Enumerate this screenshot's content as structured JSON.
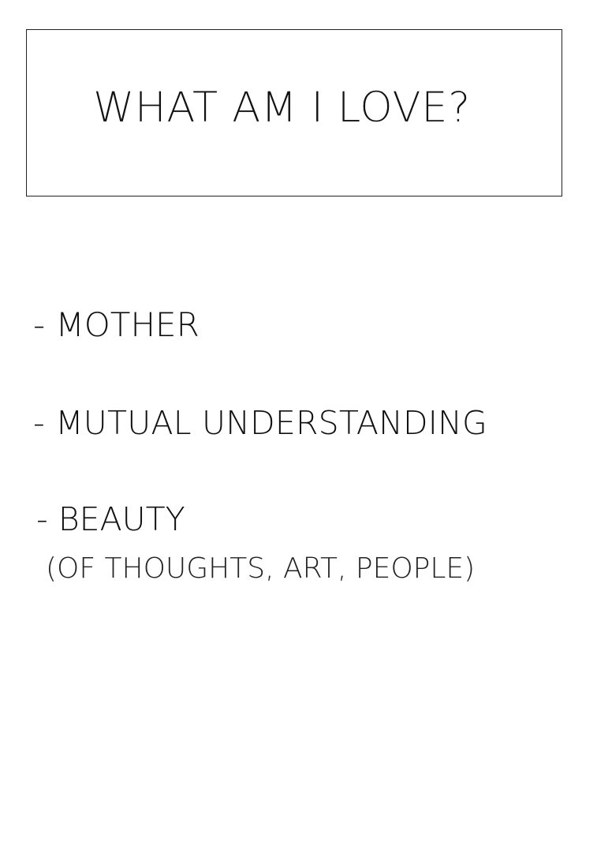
{
  "title": "WHAT AM I LOVE?",
  "items": [
    {
      "label": "- MOTHER"
    },
    {
      "label": "- MUTUAL UNDERSTANDING"
    },
    {
      "label": "- BEAUTY",
      "note": "(OF THOUGHTS, ART, PEOPLE)"
    }
  ]
}
